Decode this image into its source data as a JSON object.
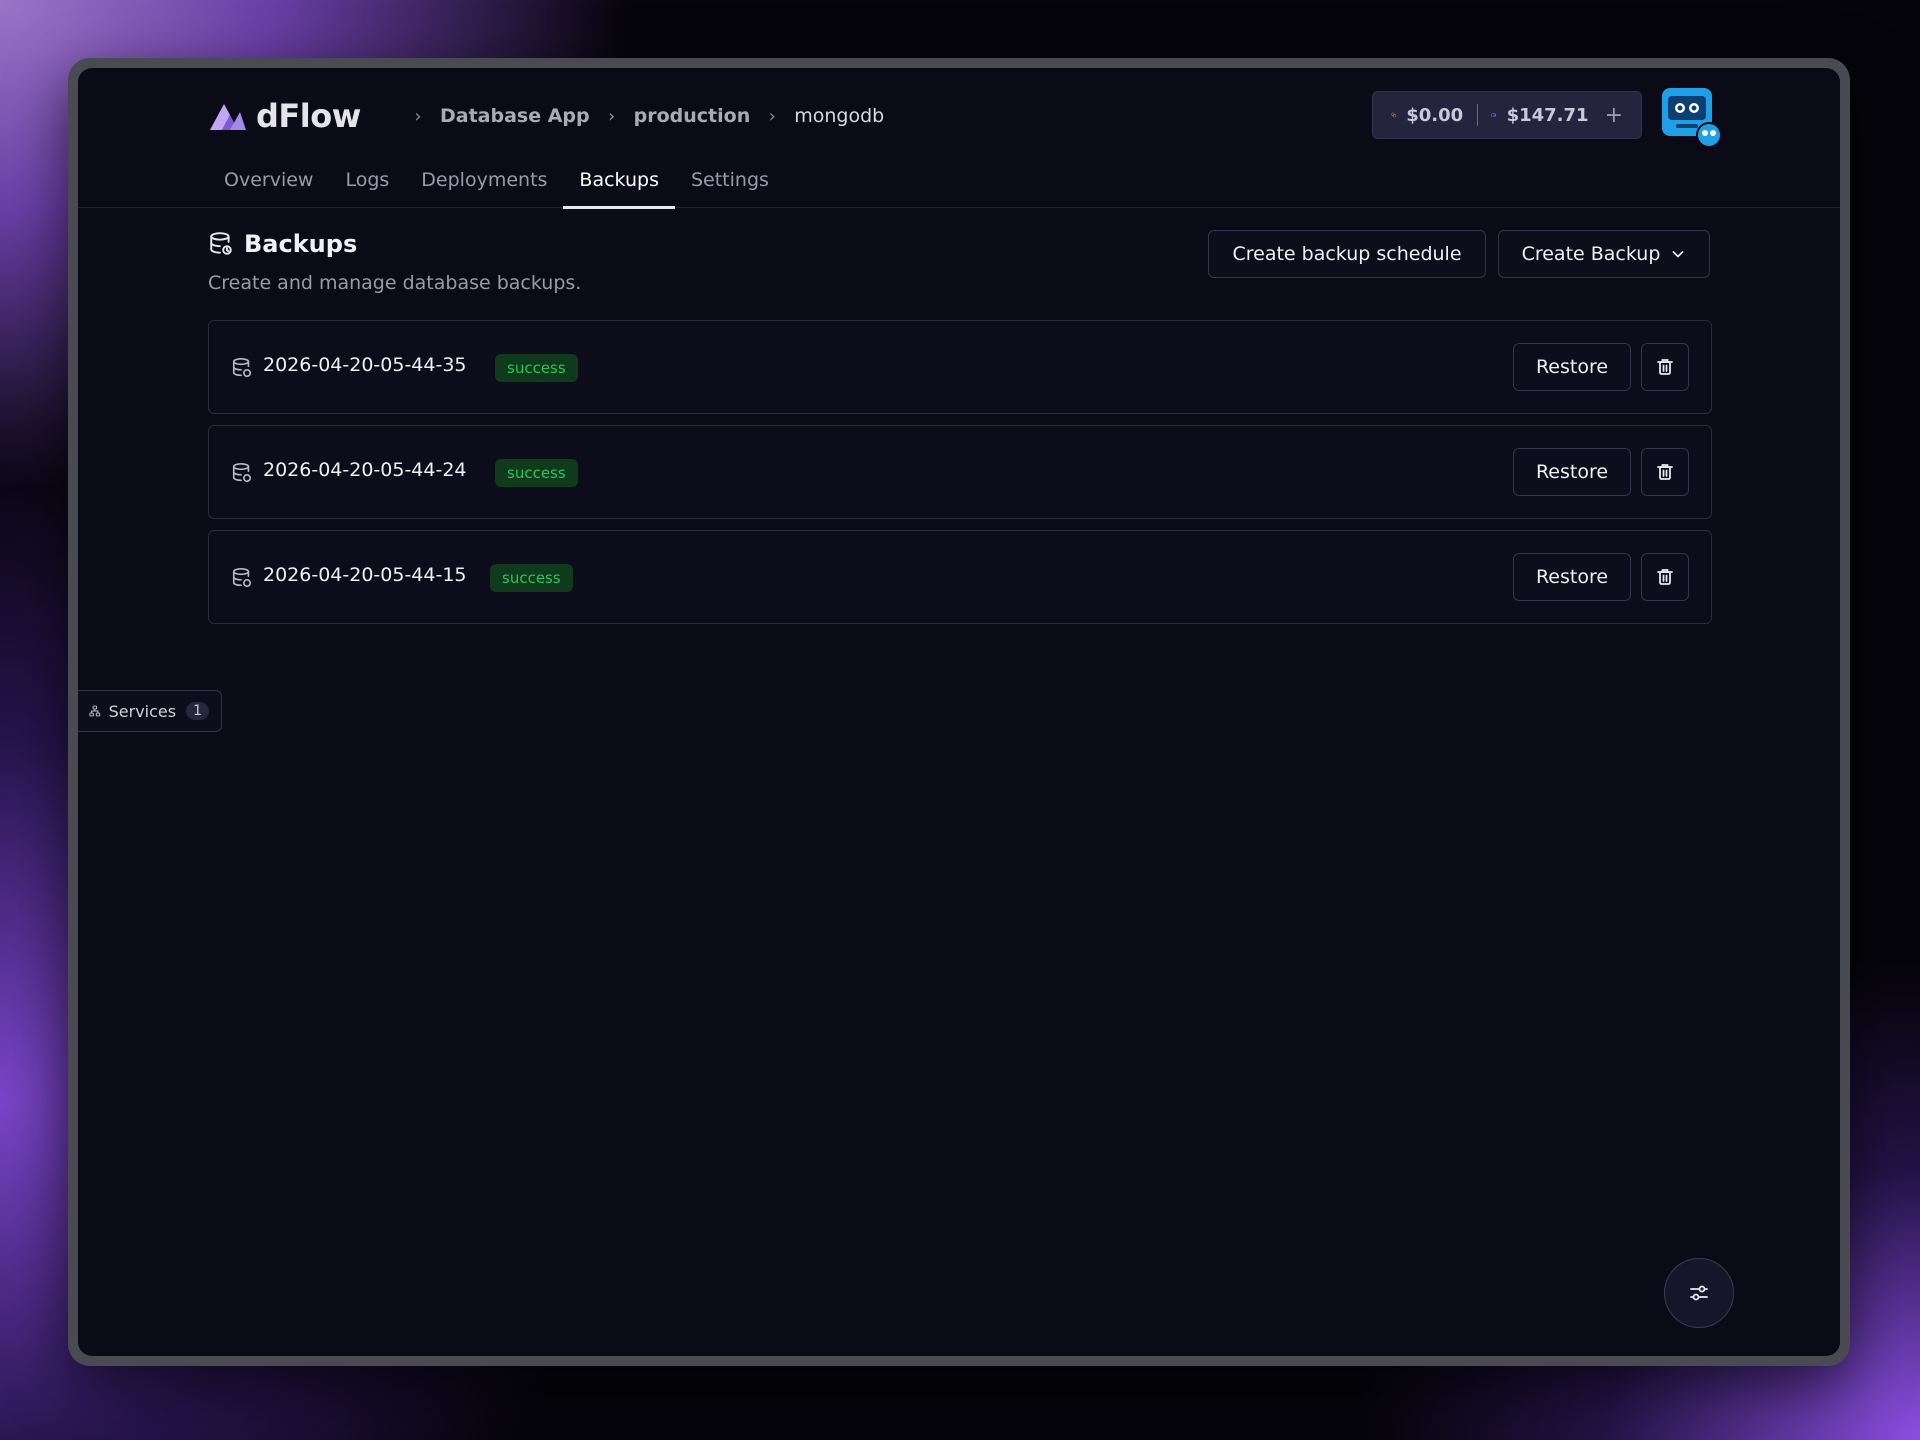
{
  "brand": {
    "name": "dFlow"
  },
  "breadcrumbs": [
    {
      "label": "Database App"
    },
    {
      "label": "production"
    },
    {
      "label": "mongodb"
    }
  ],
  "wallet": {
    "credits": "$0.00",
    "balance": "$147.71"
  },
  "tabs": [
    {
      "label": "Overview",
      "active": false
    },
    {
      "label": "Logs",
      "active": false
    },
    {
      "label": "Deployments",
      "active": false
    },
    {
      "label": "Backups",
      "active": true
    },
    {
      "label": "Settings",
      "active": false
    }
  ],
  "section": {
    "title": "Backups",
    "subtitle": "Create and manage database backups.",
    "schedule_button": "Create backup schedule",
    "create_button": "Create Backup"
  },
  "backups": [
    {
      "timestamp": "2026-04-20-05-44-35",
      "status": "success",
      "restore_label": "Restore"
    },
    {
      "timestamp": "2026-04-20-05-44-24",
      "status": "success",
      "restore_label": "Restore"
    },
    {
      "timestamp": "2026-04-20-05-44-15",
      "status": "success",
      "restore_label": "Restore"
    }
  ],
  "services_panel": {
    "label": "Services",
    "count": "1"
  },
  "colors": {
    "accent": "#8b6fe0",
    "status_success_text": "#27c65a",
    "status_success_bg": "#0f3a1c",
    "background": "#0b0b18"
  },
  "icons": {
    "logo": "dflow-logo-icon",
    "credits": "coins-icon",
    "wallet": "wallet-icon",
    "add": "plus-icon",
    "section": "database-backup-icon",
    "dropdown": "chevron-down-icon",
    "row": "database-backup-icon",
    "delete": "trash-icon",
    "services": "network-icon",
    "fab": "sliders-icon"
  }
}
